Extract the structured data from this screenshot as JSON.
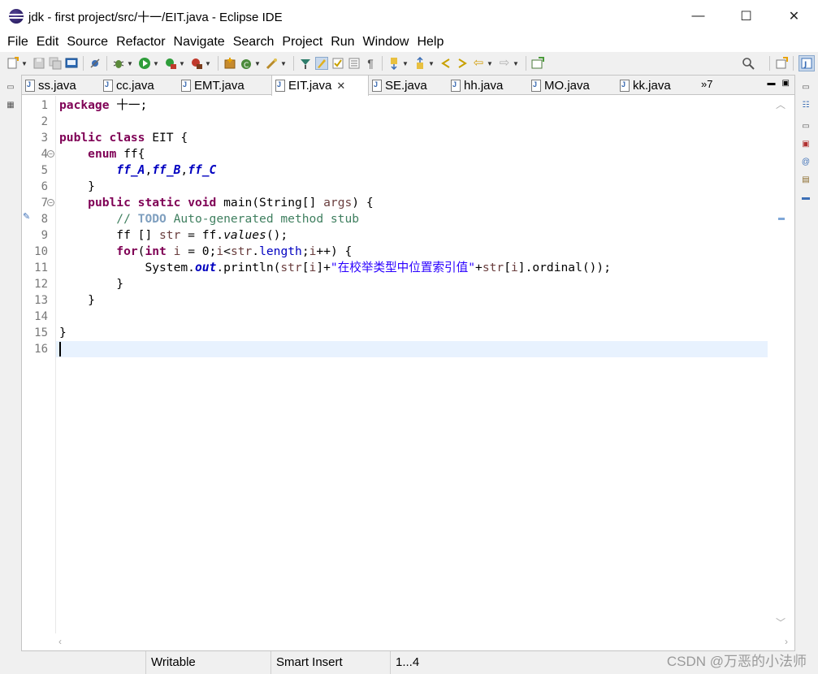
{
  "window": {
    "title": "jdk - first project/src/十一/EIT.java - Eclipse IDE",
    "controls": [
      "—",
      "☐",
      "✕"
    ]
  },
  "menu": [
    "File",
    "Edit",
    "Source",
    "Refactor",
    "Navigate",
    "Search",
    "Project",
    "Run",
    "Window",
    "Help"
  ],
  "tabs": [
    {
      "label": "ss.java",
      "active": false
    },
    {
      "label": "cc.java",
      "active": false
    },
    {
      "label": "EMT.java",
      "active": false
    },
    {
      "label": "EIT.java",
      "active": true
    },
    {
      "label": "SE.java",
      "active": false
    },
    {
      "label": "hh.java",
      "active": false
    },
    {
      "label": "MO.java",
      "active": false
    },
    {
      "label": "kk.java",
      "active": false
    }
  ],
  "tab_overflow": "»7",
  "close_glyph": "✕",
  "line_numbers": [
    "1",
    "2",
    "3",
    "4",
    "5",
    "6",
    "7",
    "8",
    "9",
    "10",
    "11",
    "12",
    "13",
    "14",
    "15",
    "16"
  ],
  "code": {
    "l1": {
      "kw": "package",
      "rest": " 十一;"
    },
    "l3": {
      "kw1": "public",
      "kw2": "class",
      "rest": " EIT {"
    },
    "l4": {
      "indent": "    ",
      "kw": "enum",
      "rest": " ff{"
    },
    "l5": {
      "indent": "        ",
      "c1": "ff_A",
      "sep1": ",",
      "c2": "ff_B",
      "sep2": ",",
      "c3": "ff_C"
    },
    "l6": "    }",
    "l7": {
      "indent": "    ",
      "kw1": "public",
      "kw2": "static",
      "kw3": "void",
      "rest": " main(String[] ",
      "arg": "args",
      "end": ") {"
    },
    "l8": {
      "indent": "        ",
      "c1": "// ",
      "todo": "TODO",
      "c2": " Auto-generated method stub"
    },
    "l9": {
      "indent": "        ",
      "a": "ff [] ",
      "var": "str",
      "b": " = ff.",
      "meth": "values",
      "c": "();"
    },
    "l10": {
      "indent": "        ",
      "kw": "for",
      "a": "(",
      "kw2": "int",
      "b": " ",
      "var1": "i",
      "c": " = 0;",
      "var2": "i",
      "d": "<",
      "var3": "str",
      "e": ".",
      "fld": "length",
      "f": ";",
      "var4": "i",
      "g": "++) {"
    },
    "l11": {
      "indent": "            ",
      "a": "System.",
      "sfld": "out",
      "b": ".println(",
      "var1": "str",
      "c": "[",
      "var2": "i",
      "d": "]+",
      "str": "\"在校举类型中位置索引值\"",
      "e": "+",
      "var3": "str",
      "f": "[",
      "var4": "i",
      "g": "].ordinal());"
    },
    "l12": "        }",
    "l13": "    }",
    "l15": "}"
  },
  "status": {
    "writable": "Writable",
    "insert_mode": "Smart Insert",
    "position": "1...4"
  },
  "watermark": "CSDN @万恶的小法师"
}
